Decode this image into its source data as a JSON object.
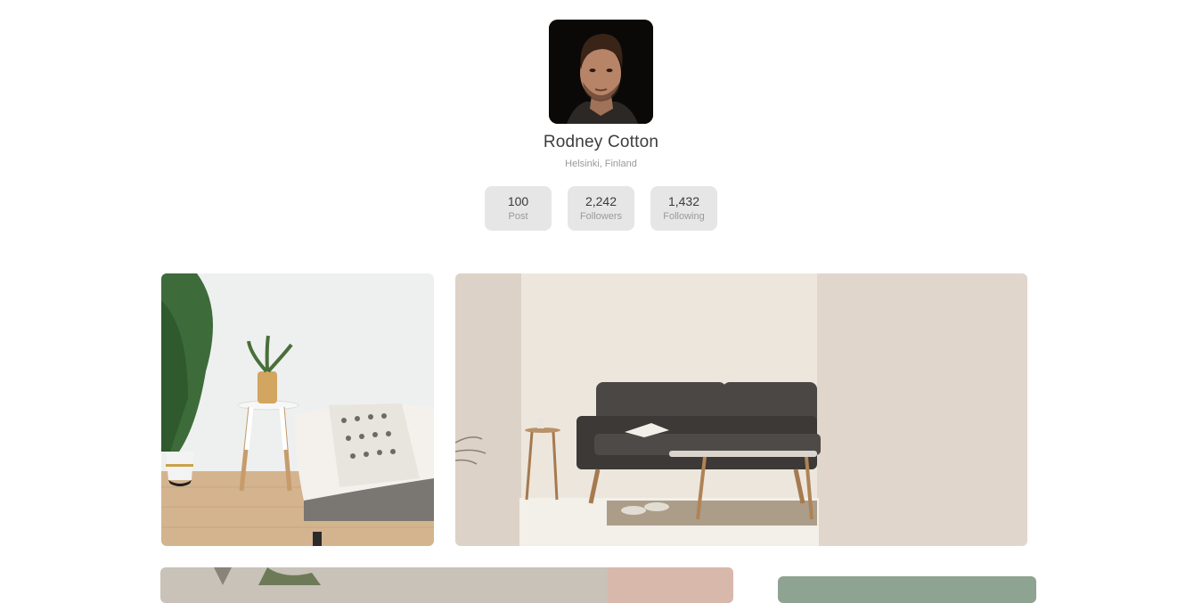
{
  "profile": {
    "name": "Rodney Cotton",
    "location": "Helsinki, Finland",
    "stats": [
      {
        "value": "100",
        "label": "Post"
      },
      {
        "value": "2,242",
        "label": "Followers"
      },
      {
        "value": "1,432",
        "label": "Following"
      }
    ]
  },
  "gallery": {
    "photos": [
      {
        "name": "photo-living-room-plants"
      },
      {
        "name": "photo-grey-sofa-room"
      },
      {
        "name": "photo-beige-interior"
      },
      {
        "name": "photo-sage-wall"
      }
    ]
  },
  "colors": {
    "stat_bg": "#e6e6e6",
    "name_text": "#3d3d3d",
    "muted_text": "#9a9a9a"
  }
}
